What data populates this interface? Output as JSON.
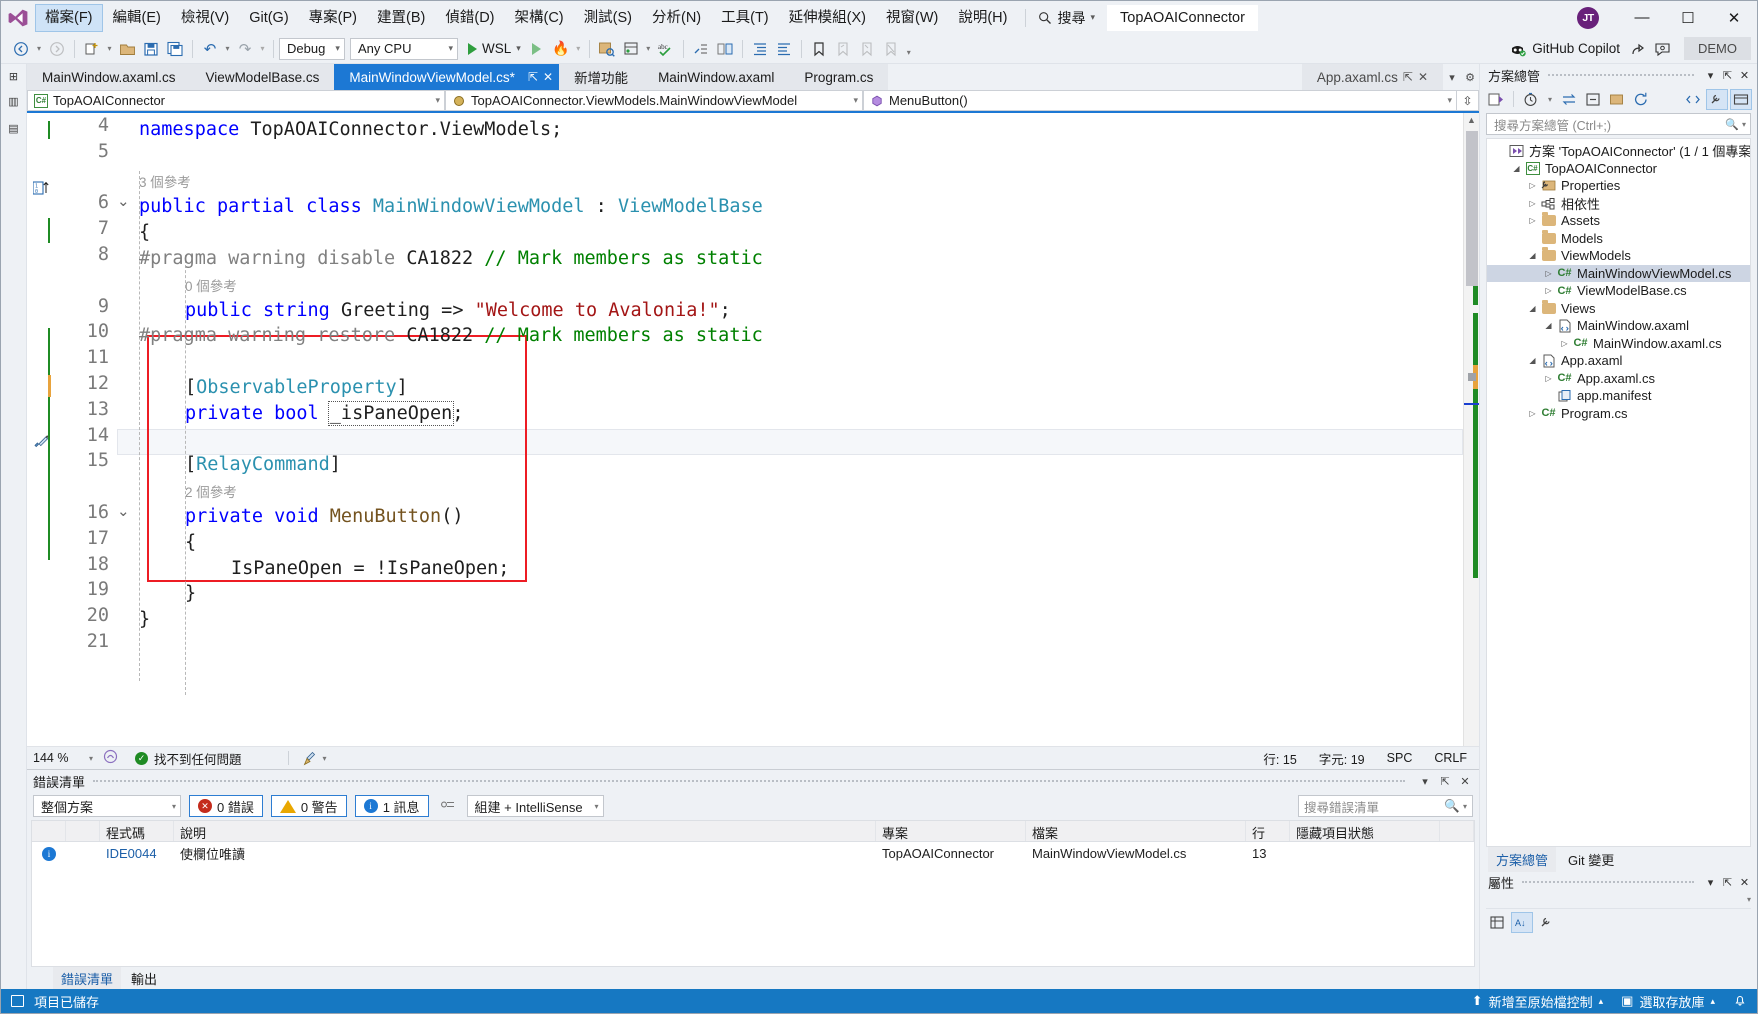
{
  "titlebar": {
    "menus": [
      {
        "label": "檔案(F)",
        "active": true
      },
      {
        "label": "編輯(E)",
        "active": false
      },
      {
        "label": "檢視(V)",
        "active": false
      },
      {
        "label": "Git(G)",
        "active": false
      },
      {
        "label": "專案(P)",
        "active": false
      },
      {
        "label": "建置(B)",
        "active": false
      },
      {
        "label": "偵錯(D)",
        "active": false
      },
      {
        "label": "架構(C)",
        "active": false
      },
      {
        "label": "測試(S)",
        "active": false
      },
      {
        "label": "分析(N)",
        "active": false
      },
      {
        "label": "工具(T)",
        "active": false
      },
      {
        "label": "延伸模組(X)",
        "active": false
      },
      {
        "label": "視窗(W)",
        "active": false
      },
      {
        "label": "說明(H)",
        "active": false
      }
    ],
    "search_label": "搜尋",
    "project_chip": "TopAOAIConnector",
    "avatar_initials": "JT",
    "minimize": "—",
    "maximize": "☐",
    "close": "✕"
  },
  "toolbar": {
    "config": "Debug",
    "platform": "Any CPU",
    "run_target": "WSL",
    "copilot_label": "GitHub Copilot",
    "demo_label": "DEMO"
  },
  "tabs": {
    "left": [
      {
        "label": "MainWindow.axaml.cs",
        "state": "inactive"
      },
      {
        "label": "ViewModelBase.cs",
        "state": "inactive"
      },
      {
        "label": "MainWindowViewModel.cs*",
        "state": "active"
      },
      {
        "label": "新增功能",
        "state": "inactive"
      },
      {
        "label": "MainWindow.axaml",
        "state": "inactive"
      },
      {
        "label": "Program.cs",
        "state": "inactive"
      }
    ],
    "right": [
      {
        "label": "App.axaml.cs",
        "state": "right"
      }
    ],
    "pin_glyph": "⇱",
    "close_glyph": "✕",
    "overflow_glyph": "▾",
    "settings_glyph": "⚙"
  },
  "navbar": {
    "project": "TopAOAIConnector",
    "type": "TopAOAIConnector.ViewModels.MainWindowViewModel",
    "member": "MenuButton()",
    "split_glyph": "⇳"
  },
  "editor": {
    "lines": [
      {
        "num": "4",
        "segs": [
          {
            "t": "namespace ",
            "c": "kw"
          },
          {
            "t": "TopAOAIConnector.ViewModels;",
            "c": "plain"
          }
        ]
      },
      {
        "num": "5",
        "segs": []
      },
      {
        "num": "",
        "codelens": "3 個參考"
      },
      {
        "num": "6",
        "fold": "v",
        "segs": [
          {
            "t": "public partial class ",
            "c": "kw"
          },
          {
            "t": "MainWindowViewModel",
            "c": "typ"
          },
          {
            "t": " : ",
            "c": "plain"
          },
          {
            "t": "ViewModelBase",
            "c": "typ"
          }
        ]
      },
      {
        "num": "7",
        "segs": [
          {
            "t": "{",
            "c": "plain"
          }
        ]
      },
      {
        "num": "8",
        "segs": [
          {
            "t": "#pragma warning disable ",
            "c": "pp"
          },
          {
            "t": "CA1822 ",
            "c": "plain"
          },
          {
            "t": "// Mark members as static",
            "c": "cmt"
          }
        ]
      },
      {
        "num": "",
        "codelens": "0 個參考",
        "indent": 1
      },
      {
        "num": "9",
        "segs": [
          {
            "t": "public string ",
            "c": "kw"
          },
          {
            "t": "Greeting => ",
            "c": "plain"
          },
          {
            "t": "\"Welcome to Avalonia!\"",
            "c": "str"
          },
          {
            "t": ";",
            "c": "plain"
          }
        ],
        "indent": 1
      },
      {
        "num": "10",
        "segs": [
          {
            "t": "#pragma warning restore ",
            "c": "pp"
          },
          {
            "t": "CA1822 ",
            "c": "plain"
          },
          {
            "t": "// Mark members as static",
            "c": "cmt"
          }
        ]
      },
      {
        "num": "11",
        "segs": []
      },
      {
        "num": "12",
        "segs": [
          {
            "t": "[",
            "c": "plain"
          },
          {
            "t": "ObservableProperty",
            "c": "typ"
          },
          {
            "t": "]",
            "c": "plain"
          }
        ],
        "indent": 1
      },
      {
        "num": "13",
        "segs": [
          {
            "t": "private bool ",
            "c": "kw"
          },
          {
            "t": "_isPaneOpen",
            "c": "plain",
            "boxed": true
          },
          {
            "t": ";",
            "c": "plain"
          }
        ],
        "indent": 1
      },
      {
        "num": "14",
        "segs": []
      },
      {
        "num": "15",
        "segs": [
          {
            "t": "[",
            "c": "plain"
          },
          {
            "t": "RelayCommand",
            "c": "typ"
          },
          {
            "t": "]",
            "c": "plain"
          }
        ],
        "indent": 1,
        "highlight": true
      },
      {
        "num": "",
        "codelens": "2 個參考",
        "indent": 1
      },
      {
        "num": "16",
        "fold": "v",
        "segs": [
          {
            "t": "private void ",
            "c": "kw"
          },
          {
            "t": "MenuButton",
            "c": "meth"
          },
          {
            "t": "()",
            "c": "plain"
          }
        ],
        "indent": 1
      },
      {
        "num": "17",
        "segs": [
          {
            "t": "{",
            "c": "plain"
          }
        ],
        "indent": 1
      },
      {
        "num": "18",
        "segs": [
          {
            "t": "IsPaneOpen = !IsPaneOpen;",
            "c": "plain"
          }
        ],
        "indent": 2
      },
      {
        "num": "19",
        "segs": [
          {
            "t": "}",
            "c": "plain"
          }
        ],
        "indent": 1
      },
      {
        "num": "20",
        "segs": [
          {
            "t": "}",
            "c": "plain"
          }
        ]
      },
      {
        "num": "21",
        "segs": []
      }
    ],
    "zoom": "144 %",
    "problems": "找不到任何問題",
    "row_label": "行: 15",
    "col_label": "字元: 19",
    "spaces_label": "SPC",
    "eol_label": "CRLF"
  },
  "errorlist": {
    "title": "錯誤清單",
    "scope": "整個方案",
    "errors_chip": "0 錯誤",
    "warnings_chip": "0 警告",
    "messages_chip": "1 訊息",
    "filter": "組建 + IntelliSense",
    "search_placeholder": "搜尋錯誤清單",
    "columns": [
      "",
      "",
      "程式碼",
      "說明",
      "專案",
      "檔案",
      "行",
      "隱藏項目狀態",
      "",
      ""
    ],
    "rows": [
      {
        "icon": "i",
        "code": "IDE0044",
        "desc": "使欄位唯讀",
        "project": "TopAOAIConnector",
        "file": "MainWindowViewModel.cs",
        "line": "13",
        "state": "",
        "sup": "",
        "extra": ""
      }
    ],
    "tabs": [
      {
        "label": "錯誤清單",
        "active": true
      },
      {
        "label": "輸出",
        "active": false
      }
    ]
  },
  "solution_explorer": {
    "title": "方案總管",
    "search_placeholder": "搜尋方案總管 (Ctrl+;)",
    "tree": [
      {
        "depth": 0,
        "twisty": "",
        "icon": "solution",
        "label": "方案 'TopAOAIConnector' (1 / 1 個專案)",
        "selected": false
      },
      {
        "depth": 1,
        "twisty": "▲",
        "icon": "csproj",
        "label": "TopAOAIConnector",
        "selected": false
      },
      {
        "depth": 2,
        "twisty": "▶",
        "icon": "props",
        "label": "Properties",
        "selected": false
      },
      {
        "depth": 2,
        "twisty": "▶",
        "icon": "deps",
        "label": "相依性",
        "selected": false
      },
      {
        "depth": 2,
        "twisty": "▶",
        "icon": "folder",
        "label": "Assets",
        "selected": false
      },
      {
        "depth": 2,
        "twisty": "",
        "icon": "folder",
        "label": "Models",
        "selected": false
      },
      {
        "depth": 2,
        "twisty": "▲",
        "icon": "folder",
        "label": "ViewModels",
        "selected": false
      },
      {
        "depth": 3,
        "twisty": "▶",
        "icon": "cs",
        "label": "MainWindowViewModel.cs",
        "selected": true
      },
      {
        "depth": 3,
        "twisty": "▶",
        "icon": "cs",
        "label": "ViewModelBase.cs",
        "selected": false
      },
      {
        "depth": 2,
        "twisty": "▲",
        "icon": "folder",
        "label": "Views",
        "selected": false
      },
      {
        "depth": 3,
        "twisty": "▲",
        "icon": "axaml",
        "label": "MainWindow.axaml",
        "selected": false
      },
      {
        "depth": 4,
        "twisty": "▶",
        "icon": "cs",
        "label": "MainWindow.axaml.cs",
        "selected": false
      },
      {
        "depth": 2,
        "twisty": "▲",
        "icon": "axaml",
        "label": "App.axaml",
        "selected": false
      },
      {
        "depth": 3,
        "twisty": "▶",
        "icon": "cs",
        "label": "App.axaml.cs",
        "selected": false
      },
      {
        "depth": 3,
        "twisty": "",
        "icon": "manifest",
        "label": "app.manifest",
        "selected": false
      },
      {
        "depth": 2,
        "twisty": "▶",
        "icon": "cs",
        "label": "Program.cs",
        "selected": false
      }
    ],
    "dock_tabs": [
      {
        "label": "方案總管",
        "active": true
      },
      {
        "label": "Git 變更",
        "active": false
      }
    ]
  },
  "properties": {
    "title": "屬性"
  },
  "statusbar": {
    "message": "項目已儲存",
    "source_control": "新增至原始檔控制",
    "select_repo": "選取存放庫",
    "bell": "🔔"
  }
}
